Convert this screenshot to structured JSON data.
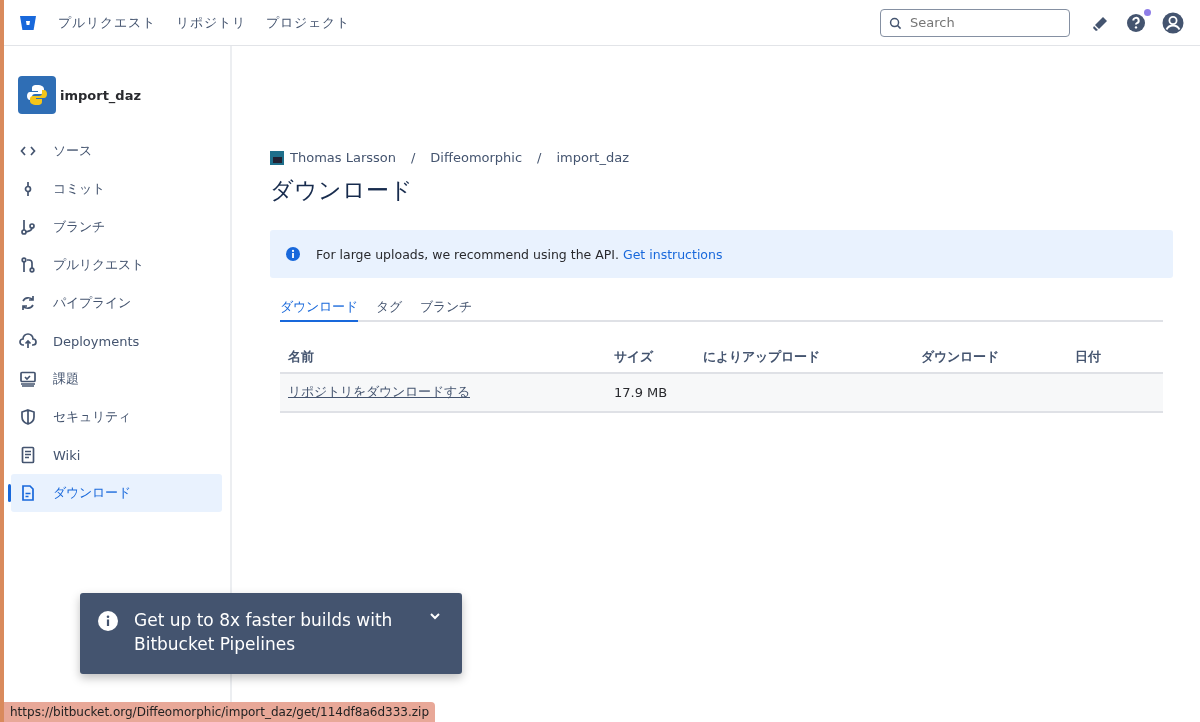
{
  "top_nav": {
    "items": [
      "プルリクエスト",
      "リポジトリ",
      "プロジェクト"
    ],
    "search": {
      "placeholder": "Search"
    },
    "help_badge": true
  },
  "sidebar": {
    "repo_name": "import_daz",
    "items": [
      {
        "label": "ソース",
        "selected": false
      },
      {
        "label": "コミット",
        "selected": false
      },
      {
        "label": "ブランチ",
        "selected": false
      },
      {
        "label": "プルリクエスト",
        "selected": false
      },
      {
        "label": "パイプライン",
        "selected": false
      },
      {
        "label": "Deployments",
        "selected": false
      },
      {
        "label": "課題",
        "selected": false
      },
      {
        "label": "セキュリティ",
        "selected": false
      },
      {
        "label": "Wiki",
        "selected": false
      },
      {
        "label": "ダウンロード",
        "selected": true
      }
    ]
  },
  "breadcrumbs": [
    {
      "kind": "link",
      "text": "Thomas Larsson"
    },
    {
      "kind": "separator",
      "text": "/"
    },
    {
      "kind": "link",
      "text": "Diffeomorphic"
    },
    {
      "kind": "separator",
      "text": "/"
    },
    {
      "kind": "link",
      "text": "import_daz"
    }
  ],
  "title": "ダウンロード",
  "banner": {
    "text": "For large uploads, we recommend using the API.",
    "link": "Get instructions"
  },
  "tabs": [
    {
      "label": "ダウンロード",
      "selected": true
    },
    {
      "label": "タグ",
      "selected": false
    },
    {
      "label": "ブランチ",
      "selected": false
    }
  ],
  "table": {
    "columns": [
      "名前",
      "サイズ",
      "によりアップロード",
      "ダウンロード",
      "日付"
    ],
    "rows": [
      [
        "リポジトリをダウンロードする",
        "17.9 MB",
        "",
        "",
        ""
      ]
    ]
  },
  "toast": {
    "text": "Get up to 8x faster builds with Bitbucket Pipelines"
  },
  "status_url": "https://bitbucket.org/Diffeomorphic/import_daz/get/114df8a6d333.zip"
}
